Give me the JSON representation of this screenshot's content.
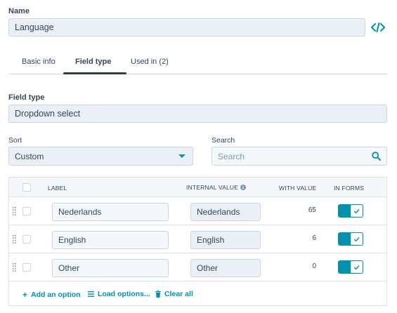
{
  "name_section": {
    "label": "Name",
    "value": "Language"
  },
  "icons": {
    "code": "code-icon",
    "search": "search-icon",
    "info": "info-icon",
    "drag": "drag-handle-icon",
    "check": "check-icon",
    "plus": "plus-icon",
    "list": "list-icon",
    "trash": "trash-icon"
  },
  "tabs": [
    {
      "label": "Basic info",
      "active": false
    },
    {
      "label": "Field type",
      "active": true
    },
    {
      "label": "Used in (2)",
      "active": false
    }
  ],
  "field_type": {
    "label": "Field type",
    "value": "Dropdown select"
  },
  "sort": {
    "label": "Sort",
    "value": "Custom"
  },
  "search": {
    "label": "Search",
    "placeholder": "Search"
  },
  "table": {
    "headers": {
      "label": "LABEL",
      "internal_value": "INTERNAL VALUE",
      "with_value": "WITH VALUE",
      "in_forms": "IN FORMS"
    },
    "rows": [
      {
        "label": "Nederlands",
        "internal_value": "Nederlands",
        "with_value": "65",
        "in_forms": true
      },
      {
        "label": "English",
        "internal_value": "English",
        "with_value": "6",
        "in_forms": true
      },
      {
        "label": "Other",
        "internal_value": "Other",
        "with_value": "0",
        "in_forms": true
      }
    ]
  },
  "actions": {
    "add": "Add an option",
    "load": "Load options...",
    "clear": "Clear all"
  },
  "colors": {
    "accent": "#0091ae",
    "text": "#33475b",
    "field_bg": "#eaf0f6",
    "border": "#cbd6e2"
  }
}
